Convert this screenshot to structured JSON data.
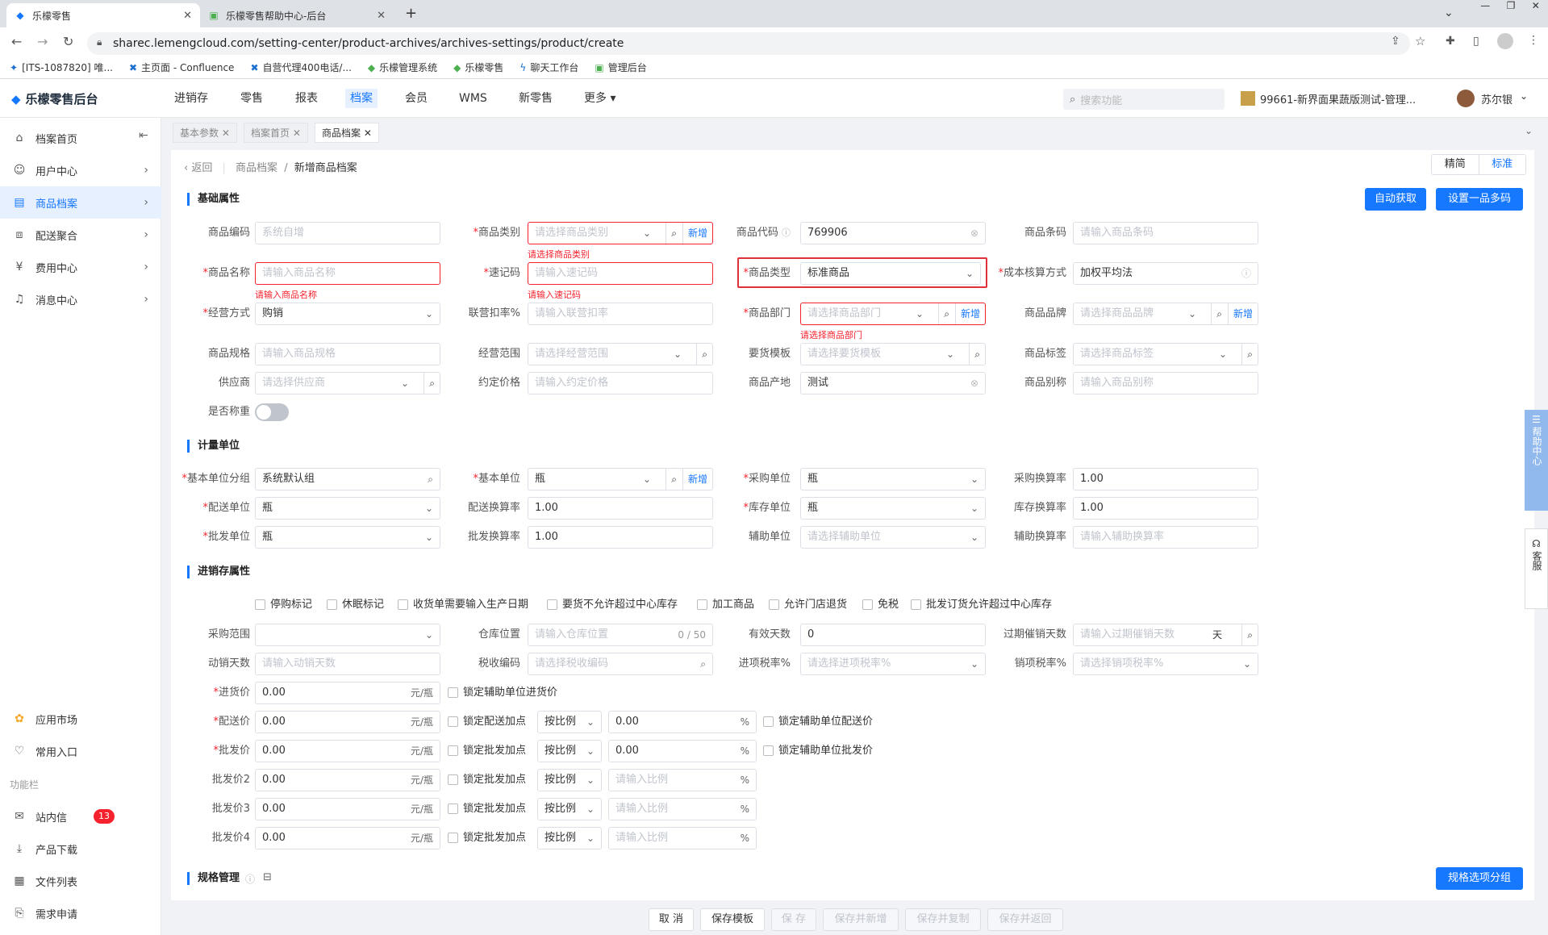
{
  "browser": {
    "tabs": [
      {
        "title": "乐檬零售",
        "active": true
      },
      {
        "title": "乐檬零售帮助中心-后台",
        "active": false
      }
    ],
    "url": "sharec.lemengcloud.com/setting-center/product-archives/archives-settings/product/create",
    "bookmarks": [
      "[ITS-1087820] 唯...",
      "主页面 - Confluence",
      "自营代理400电话/...",
      "乐檬管理系统",
      "乐檬零售",
      "聊天工作台",
      "管理后台"
    ]
  },
  "app": {
    "logo": "乐檬零售后台",
    "nav": [
      "进销存",
      "零售",
      "报表",
      "档案",
      "会员",
      "WMS",
      "新零售",
      "更多"
    ],
    "active_nav": "档案",
    "search_placeholder": "搜索功能",
    "store": "99661-新界面果蔬版测试-管理...",
    "user": "苏尔银"
  },
  "sidebar": {
    "items": [
      {
        "label": "档案首页",
        "icon": "home-icon"
      },
      {
        "label": "用户中心",
        "icon": "user-icon"
      },
      {
        "label": "商品档案",
        "icon": "box-icon",
        "active": true
      },
      {
        "label": "配送聚合",
        "icon": "truck-icon"
      },
      {
        "label": "费用中心",
        "icon": "money-icon"
      },
      {
        "label": "消息中心",
        "icon": "bell-icon"
      }
    ],
    "bottom": [
      {
        "label": "应用市场",
        "icon": "apps-icon"
      },
      {
        "label": "常用入口",
        "icon": "heart-icon"
      }
    ],
    "func_title": "功能栏",
    "func": [
      {
        "label": "站内信",
        "icon": "mail-icon",
        "badge": "13"
      },
      {
        "label": "产品下载",
        "icon": "download-icon"
      },
      {
        "label": "文件列表",
        "icon": "file-icon"
      },
      {
        "label": "需求申请",
        "icon": "request-icon"
      }
    ]
  },
  "pagetabs": [
    "基本参数",
    "档案首页",
    "商品档案"
  ],
  "crumb": {
    "back": "返回",
    "parent": "商品档案",
    "current": "新增商品档案"
  },
  "mode": {
    "simple": "精简",
    "standard": "标准"
  },
  "sections": {
    "basic": "基础属性",
    "unit": "计量单位",
    "inv": "进销存属性",
    "spec": "规格管理"
  },
  "buttons": {
    "auto": "自动获取",
    "multicode": "设置一品多码",
    "specgroup": "规格选项分组",
    "add": "新增"
  },
  "basic": {
    "code_label": "商品编码",
    "code_ph": "系统自增",
    "cat_label": "商品类别",
    "cat_ph": "请选择商品类别",
    "cat_err": "请选择商品类别",
    "pcode_label": "商品代码",
    "pcode_val": "769906",
    "barcode_label": "商品条码",
    "barcode_ph": "请输入商品条码",
    "name_label": "商品名称",
    "name_ph": "请输入商品名称",
    "name_err": "请输入商品名称",
    "quick_label": "速记码",
    "quick_ph": "请输入速记码",
    "quick_err": "请输入速记码",
    "type_label": "商品类型",
    "type_val": "标准商品",
    "cost_label": "成本核算方式",
    "cost_val": "加权平均法",
    "mgmt_label": "经营方式",
    "mgmt_val": "购销",
    "rate_label": "联营扣率%",
    "rate_ph": "请输入联营扣率",
    "dept_label": "商品部门",
    "dept_ph": "请选择商品部门",
    "dept_err": "请选择商品部门",
    "brand_label": "商品品牌",
    "brand_ph": "请选择商品品牌",
    "spec_label": "商品规格",
    "spec_ph": "请输入商品规格",
    "scope_label": "经营范围",
    "scope_ph": "请选择经营范围",
    "tpl_label": "要货模板",
    "tpl_ph": "请选择要货模板",
    "tag_label": "商品标签",
    "tag_ph": "请选择商品标签",
    "supplier_label": "供应商",
    "supplier_ph": "请选择供应商",
    "price_label": "约定价格",
    "price_ph": "请输入约定价格",
    "origin_label": "商品产地",
    "origin_val": "测试",
    "alias_label": "商品别称",
    "alias_ph": "请输入商品别称",
    "weigh_label": "是否称重"
  },
  "unit": {
    "group_label": "基本单位分组",
    "group_val": "系统默认组",
    "base_label": "基本单位",
    "base_val": "瓶",
    "purchase_label": "采购单位",
    "purchase_val": "瓶",
    "pconv_label": "采购换算率",
    "pconv_val": "1.00",
    "dist_label": "配送单位",
    "dist_val": "瓶",
    "dconv_label": "配送换算率",
    "dconv_val": "1.00",
    "stock_label": "库存单位",
    "stock_val": "瓶",
    "sconv_label": "库存换算率",
    "sconv_val": "1.00",
    "whole_label": "批发单位",
    "whole_val": "瓶",
    "wconv_label": "批发换算率",
    "wconv_val": "1.00",
    "aux_label": "辅助单位",
    "aux_ph": "请选择辅助单位",
    "aconv_label": "辅助换算率",
    "aconv_ph": "请输入辅助换算率"
  },
  "inv": {
    "checks": [
      "停购标记",
      "休眠标记",
      "收货单需要输入生产日期",
      "要货不允许超过中心库存",
      "加工商品",
      "允许门店退货",
      "免税",
      "批发订货允许超过中心库存"
    ],
    "prange_label": "采购范围",
    "loc_label": "仓库位置",
    "loc_ph": "请输入仓库位置",
    "loc_count": "0 / 50",
    "valid_label": "有效天数",
    "valid_val": "0",
    "expire_label": "过期催销天数",
    "expire_ph": "请输入过期催销天数",
    "expire_unit": "天",
    "move_label": "动销天数",
    "move_ph": "请输入动销天数",
    "tax_label": "税收编码",
    "tax_ph": "请选择税收编码",
    "intax_label": "进项税率%",
    "intax_ph": "请选择进项税率%",
    "outtax_label": "销项税率%",
    "outtax_ph": "请选择销项税率%",
    "prices": [
      {
        "label": "进货价",
        "req": true,
        "val": "0.00",
        "lock": "锁定辅助单位进货价"
      },
      {
        "label": "配送价",
        "req": true,
        "val": "0.00",
        "lock": "锁定配送加点",
        "mode": "按比例",
        "pct": "0.00",
        "lock2": "锁定辅助单位配送价"
      },
      {
        "label": "批发价",
        "req": true,
        "val": "0.00",
        "lock": "锁定批发加点",
        "mode": "按比例",
        "pct": "0.00",
        "lock2": "锁定辅助单位批发价"
      },
      {
        "label": "批发价2",
        "req": false,
        "val": "0.00",
        "lock": "锁定批发加点",
        "mode": "按比例",
        "pct_ph": "请输入比例"
      },
      {
        "label": "批发价3",
        "req": false,
        "val": "0.00",
        "lock": "锁定批发加点",
        "mode": "按比例",
        "pct_ph": "请输入比例"
      },
      {
        "label": "批发价4",
        "req": false,
        "val": "0.00",
        "lock": "锁定批发加点",
        "mode": "按比例",
        "pct_ph": "请输入比例"
      }
    ],
    "unit_suffix": "元/瓶",
    "pct_suffix": "%"
  },
  "footer": [
    "取 消",
    "保存模板",
    "保 存",
    "保存并新增",
    "保存并复制",
    "保存并返回"
  ],
  "help": {
    "side": "帮助中心",
    "kefu": "客服"
  }
}
